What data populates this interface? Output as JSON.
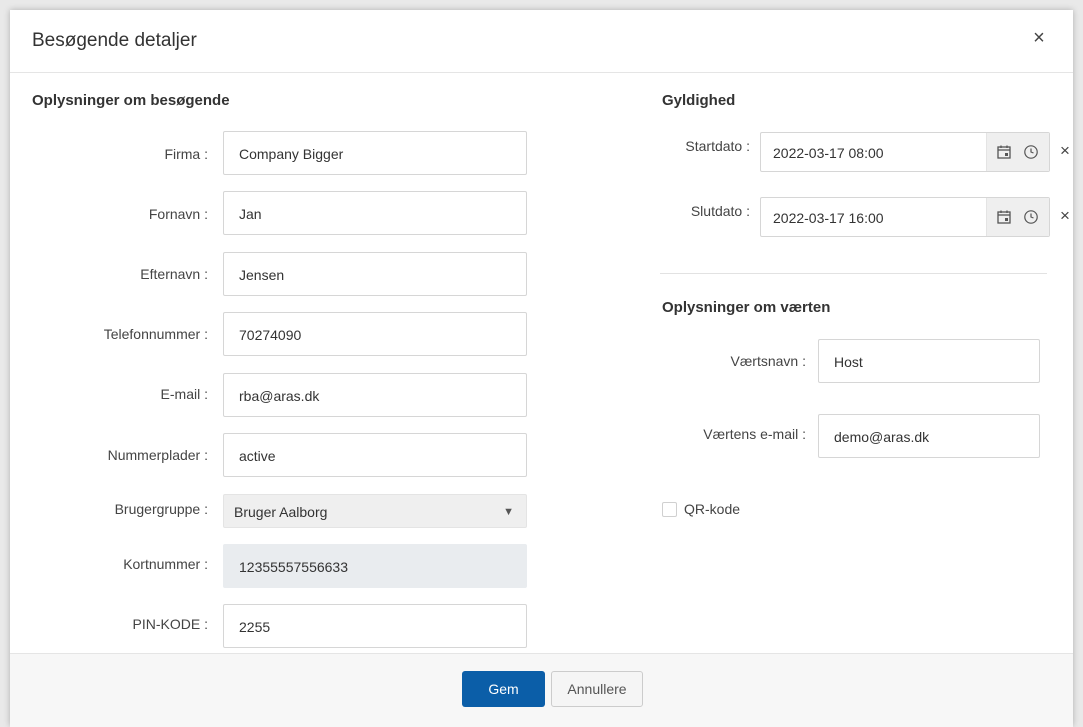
{
  "dialog": {
    "title": "Besøgende detaljer",
    "close_label": "×"
  },
  "visitor": {
    "section_title": "Oplysninger om besøgende",
    "fields": {
      "company": {
        "label": "Firma :",
        "value": "Company Bigger"
      },
      "first_name": {
        "label": "Fornavn :",
        "value": "Jan"
      },
      "last_name": {
        "label": "Efternavn :",
        "value": "Jensen"
      },
      "phone": {
        "label": "Telefonnummer :",
        "value": "70274090"
      },
      "email": {
        "label": "E-mail :",
        "value": "rba@aras.dk"
      },
      "plates": {
        "label": "Nummerplader :",
        "value": "active"
      },
      "user_group": {
        "label": "Brugergruppe :",
        "value": "Bruger Aalborg"
      },
      "card_number": {
        "label": "Kortnummer :",
        "value": "12355557556633"
      },
      "pin": {
        "label": "PIN-KODE :",
        "value": "2255"
      }
    }
  },
  "validity": {
    "section_title": "Gyldighed",
    "start": {
      "label": "Startdato :",
      "value": "2022-03-17 08:00"
    },
    "end": {
      "label": "Slutdato :",
      "value": "2022-03-17 16:00"
    },
    "clear_label": "×"
  },
  "host": {
    "section_title": "Oplysninger om værten",
    "name": {
      "label": "Værtsnavn :",
      "value": "Host"
    },
    "email": {
      "label": "Værtens e-mail :",
      "value": "demo@aras.dk"
    }
  },
  "qr": {
    "label": "QR-kode",
    "checked": false
  },
  "footer": {
    "save_label": "Gem",
    "cancel_label": "Annullere"
  },
  "colors": {
    "primary": "#0b5ea8",
    "disabled_bg": "#e9ecef"
  }
}
